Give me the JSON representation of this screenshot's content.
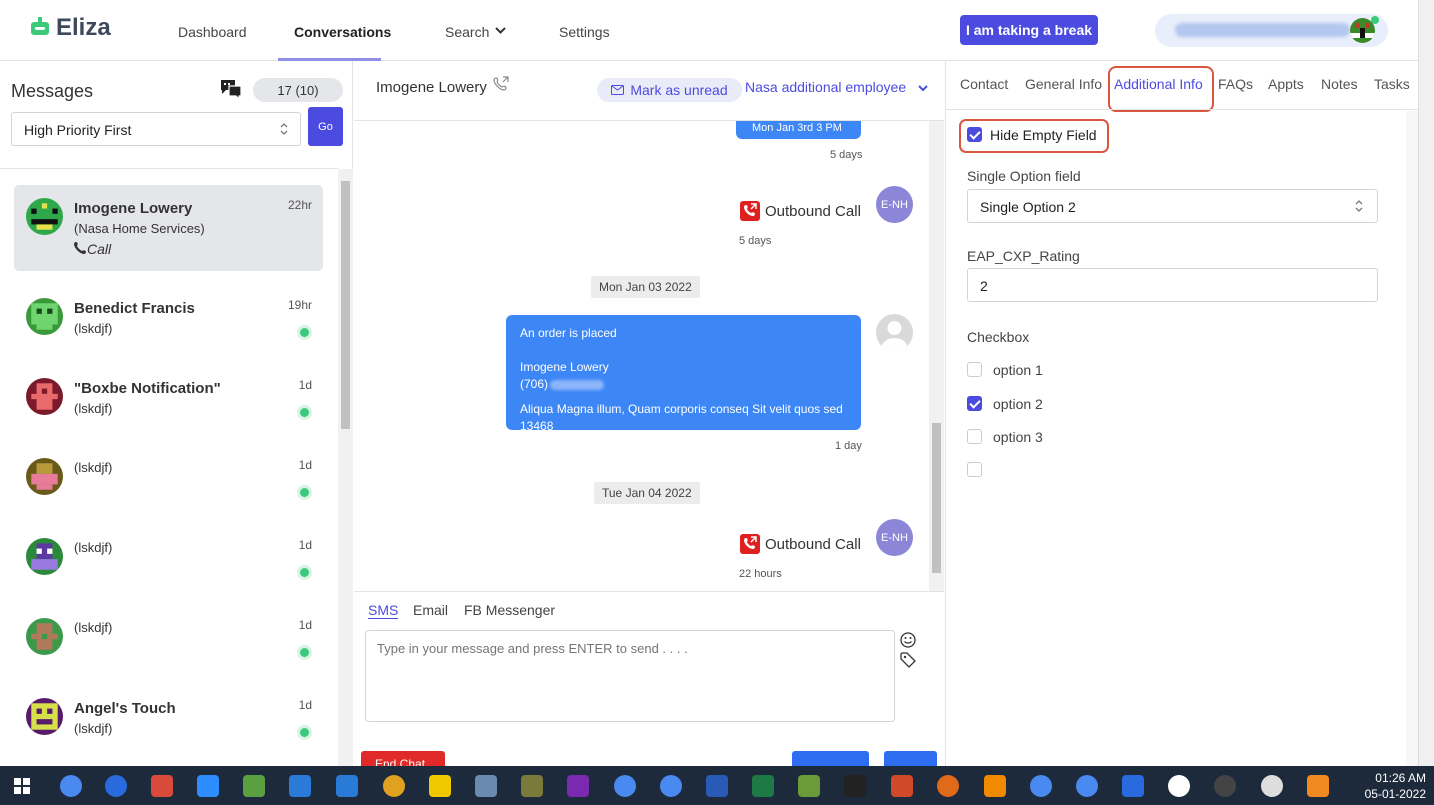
{
  "app": {
    "name": "Eliza"
  },
  "nav": {
    "dashboard": "Dashboard",
    "conversations": "Conversations",
    "search": "Search",
    "settings": "Settings"
  },
  "header": {
    "break_button": "I am taking a break"
  },
  "messages": {
    "title": "Messages",
    "count": "17 (10)",
    "sort_value": "High Priority First",
    "go": "Go",
    "conversations": [
      {
        "name": "Imogene Lowery",
        "sub": "(Nasa Home Services)",
        "time": "22hr",
        "last": "Call"
      },
      {
        "name": "Benedict Francis",
        "sub": "(lskdjf)",
        "time": "19hr"
      },
      {
        "name": "\"Boxbe Notification\"",
        "sub": "(lskdjf)",
        "time": "1d"
      },
      {
        "name": "",
        "sub": "(lskdjf)",
        "time": "1d"
      },
      {
        "name": "",
        "sub": "(lskdjf)",
        "time": "1d"
      },
      {
        "name": "",
        "sub": "(lskdjf)",
        "time": "1d"
      },
      {
        "name": "Angel's Touch",
        "sub": "(lskdjf)",
        "time": "1d"
      }
    ]
  },
  "conversation": {
    "contact_name": "Imogene Lowery",
    "mark_unread": "Mark as unread",
    "employee": "Nasa additional employee",
    "thread": {
      "top_bubble_text": "Mon Jan 3rd 3 PM",
      "top_bubble_time": "5 days",
      "call1_label": "Outbound Call",
      "call1_time": "5 days",
      "call1_agent": "E-NH",
      "date1": "Mon Jan 03 2022",
      "order_line1": "An order is placed",
      "order_line2": "Imogene Lowery",
      "order_phone": "(706)",
      "order_line4": "Aliqua Magna illum, Quam corporis conseq Sit velit quos sed 13468",
      "order_time": "1 day",
      "date2": "Tue Jan 04 2022",
      "call2_label": "Outbound Call",
      "call2_time": "22 hours",
      "call2_agent": "E-NH"
    },
    "composer": {
      "tab_sms": "SMS",
      "tab_email": "Email",
      "tab_fb": "FB Messenger",
      "placeholder": "Type in your message and press ENTER to send . . . .",
      "end_chat": "End Chat"
    }
  },
  "details": {
    "tabs": [
      "Contact",
      "General Info",
      "Additional Info",
      "FAQs",
      "Appts",
      "Notes",
      "Tasks"
    ],
    "hide_empty": "Hide Empty Field",
    "single_option_label": "Single Option field",
    "single_option_value": "Single Option 2",
    "eap_label": "EAP_CXP_Rating",
    "eap_value": "2",
    "checkbox_label": "Checkbox",
    "options": [
      "option 1",
      "option 2",
      "option 3"
    ]
  },
  "taskbar": {
    "time": "01:26 AM",
    "date": "05-01-2022"
  },
  "colors": {
    "accent": "#4b4be0",
    "bubble": "#3d86f6",
    "highlight": "#d9573e"
  }
}
